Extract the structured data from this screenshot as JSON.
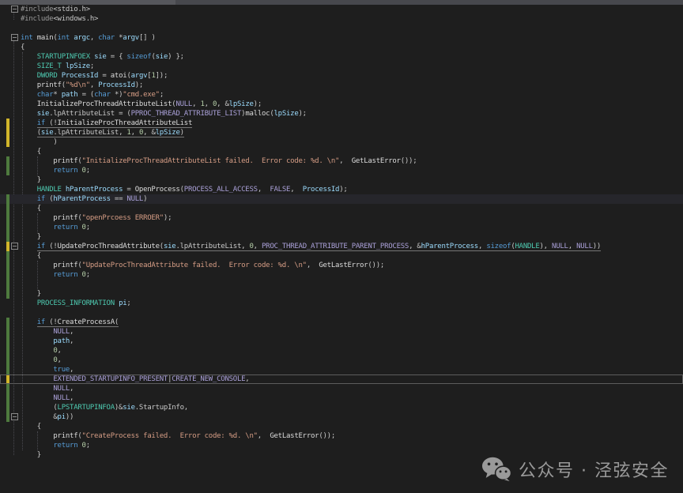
{
  "editor": {
    "palette": {
      "background": "#1e1e1e",
      "keyword": "#569cd6",
      "type": "#4ec9b0",
      "macro": "#aaa0d8",
      "local_variable": "#9cdcfe",
      "function": "#dcdcdc",
      "string": "#d69d85",
      "number": "#b5cea8",
      "plain": "#c8c8c8",
      "track_modified_unsaved": "#d1b52a",
      "track_modified_saved": "#4e7a3e"
    },
    "lines": [
      {
        "s": [
          [
            "pp",
            "#include"
          ],
          [
            "pl",
            "<stdio.h>"
          ]
        ],
        "fold": true
      },
      {
        "s": [
          [
            "pp",
            "#include"
          ],
          [
            "pl",
            "<windows.h>"
          ]
        ]
      },
      {
        "s": []
      },
      {
        "s": [
          [
            "kw",
            "int"
          ],
          [
            "pl",
            " "
          ],
          [
            "fn",
            "main"
          ],
          [
            "pl",
            "("
          ],
          [
            "kw",
            "int"
          ],
          [
            "pl",
            " "
          ],
          [
            "lv",
            "argc"
          ],
          [
            "pl",
            ", "
          ],
          [
            "kw",
            "char"
          ],
          [
            "pl",
            " *"
          ],
          [
            "lv",
            "argv"
          ],
          [
            "pl",
            "[] )"
          ]
        ],
        "fold": true
      },
      {
        "s": [
          [
            "pl",
            "{"
          ]
        ]
      },
      {
        "i": 4,
        "s": [
          [
            "ty",
            "STARTUPINFOEX"
          ],
          [
            "pl",
            " "
          ],
          [
            "lv",
            "sie"
          ],
          [
            "pl",
            " = { "
          ],
          [
            "kw",
            "sizeof"
          ],
          [
            "pl",
            "("
          ],
          [
            "lv",
            "sie"
          ],
          [
            "pl",
            ") };"
          ]
        ]
      },
      {
        "i": 4,
        "s": [
          [
            "ty",
            "SIZE_T"
          ],
          [
            "pl",
            " "
          ],
          [
            "lv",
            "lpSize"
          ],
          [
            "pl",
            ";"
          ]
        ]
      },
      {
        "i": 4,
        "s": [
          [
            "ty",
            "DWORD"
          ],
          [
            "pl",
            " "
          ],
          [
            "lv",
            "ProcessId"
          ],
          [
            "pl",
            " = "
          ],
          [
            "fn",
            "atoi"
          ],
          [
            "pl",
            "("
          ],
          [
            "lv",
            "argv"
          ],
          [
            "pl",
            "["
          ],
          [
            "nm",
            "1"
          ],
          [
            "pl",
            "]);"
          ]
        ]
      },
      {
        "i": 4,
        "s": [
          [
            "fn",
            "printf"
          ],
          [
            "pl",
            "("
          ],
          [
            "st",
            "\"%d\\n\""
          ],
          [
            "pl",
            ", "
          ],
          [
            "lv",
            "ProcessId"
          ],
          [
            "pl",
            ");"
          ]
        ]
      },
      {
        "i": 4,
        "s": [
          [
            "kw",
            "char"
          ],
          [
            "pl",
            "* "
          ],
          [
            "lv",
            "path"
          ],
          [
            "pl",
            " = ("
          ],
          [
            "kw",
            "char"
          ],
          [
            "pl",
            " *)"
          ],
          [
            "st",
            "\"cmd.exe\""
          ],
          [
            "pl",
            ";"
          ]
        ]
      },
      {
        "i": 4,
        "s": [
          [
            "fn",
            "InitializeProcThreadAttributeList"
          ],
          [
            "pl",
            "("
          ],
          [
            "mc",
            "NULL"
          ],
          [
            "pl",
            ", "
          ],
          [
            "nm",
            "1"
          ],
          [
            "pl",
            ", "
          ],
          [
            "nm",
            "0"
          ],
          [
            "pl",
            ", &"
          ],
          [
            "lv",
            "lpSize"
          ],
          [
            "pl",
            ");"
          ]
        ]
      },
      {
        "i": 4,
        "s": [
          [
            "lv",
            "sie"
          ],
          [
            "pl",
            ".lpAttributeList = ("
          ],
          [
            "mc",
            "PPROC_THREAD_ATTRIBUTE_LIST"
          ],
          [
            "pl",
            ")"
          ],
          [
            "fn",
            "malloc"
          ],
          [
            "pl",
            "("
          ],
          [
            "lv",
            "lpSize"
          ],
          [
            "pl",
            ");"
          ]
        ]
      },
      {
        "i": 4,
        "bar": "y",
        "u": true,
        "s": [
          [
            "kw",
            "if"
          ],
          [
            "pl",
            " (!"
          ],
          [
            "fn",
            "InitializeProcThreadAttributeList"
          ]
        ]
      },
      {
        "i": 4,
        "bar": "y",
        "u": true,
        "s": [
          [
            "pl",
            "("
          ],
          [
            "lv",
            "sie"
          ],
          [
            "pl",
            ".lpAttributeList, "
          ],
          [
            "nm",
            "1"
          ],
          [
            "pl",
            ", "
          ],
          [
            "nm",
            "0"
          ],
          [
            "pl",
            ", &"
          ],
          [
            "lv",
            "lpSize"
          ],
          [
            "pl",
            ")"
          ]
        ]
      },
      {
        "i": 8,
        "bar": "y",
        "s": [
          [
            "pl",
            ")"
          ]
        ]
      },
      {
        "i": 4,
        "s": [
          [
            "pl",
            "{"
          ]
        ]
      },
      {
        "i": 8,
        "bar": "g",
        "s": [
          [
            "fn",
            "printf"
          ],
          [
            "pl",
            "("
          ],
          [
            "st",
            "\"InitializeProcThreadAttributeList failed.  Error code: %d. \\n\""
          ],
          [
            "pl",
            ",  "
          ],
          [
            "fn",
            "GetLastError"
          ],
          [
            "pl",
            "());"
          ]
        ]
      },
      {
        "i": 8,
        "bar": "g",
        "s": [
          [
            "kw",
            "return"
          ],
          [
            "pl",
            " "
          ],
          [
            "nm",
            "0"
          ],
          [
            "pl",
            ";"
          ]
        ]
      },
      {
        "i": 4,
        "s": [
          [
            "pl",
            "}"
          ]
        ]
      },
      {
        "i": 4,
        "s": [
          [
            "ty",
            "HANDLE"
          ],
          [
            "pl",
            " "
          ],
          [
            "lv",
            "hParentProcess"
          ],
          [
            "pl",
            " = "
          ],
          [
            "fn",
            "OpenProcess"
          ],
          [
            "pl",
            "("
          ],
          [
            "mc",
            "PROCESS_ALL_ACCESS"
          ],
          [
            "pl",
            ",  "
          ],
          [
            "mc",
            "FALSE"
          ],
          [
            "pl",
            ",  "
          ],
          [
            "lv",
            "ProcessId"
          ],
          [
            "pl",
            ");"
          ]
        ]
      },
      {
        "i": 4,
        "bar": "g",
        "hl": true,
        "s": [
          [
            "kw",
            "if"
          ],
          [
            "pl",
            " ("
          ],
          [
            "lv",
            "hParentProcess"
          ],
          [
            "pl",
            " == "
          ],
          [
            "mc",
            "NULL"
          ],
          [
            "pl",
            ")"
          ]
        ]
      },
      {
        "i": 4,
        "bar": "g",
        "s": [
          [
            "pl",
            "{"
          ]
        ]
      },
      {
        "i": 8,
        "bar": "g",
        "s": [
          [
            "fn",
            "printf"
          ],
          [
            "pl",
            "("
          ],
          [
            "st",
            "\"openPrcoess ERROER\""
          ],
          [
            "pl",
            ");"
          ]
        ]
      },
      {
        "i": 8,
        "bar": "g",
        "s": [
          [
            "kw",
            "return"
          ],
          [
            "pl",
            " "
          ],
          [
            "nm",
            "0"
          ],
          [
            "pl",
            ";"
          ]
        ]
      },
      {
        "i": 4,
        "bar": "g",
        "s": [
          [
            "pl",
            "}"
          ]
        ]
      },
      {
        "i": 4,
        "bar": "y",
        "u": true,
        "fold": true,
        "s": [
          [
            "kw",
            "if"
          ],
          [
            "pl",
            " (!"
          ],
          [
            "fn",
            "UpdateProcThreadAttribute"
          ],
          [
            "pl",
            "("
          ],
          [
            "lv",
            "sie"
          ],
          [
            "pl",
            ".lpAttributeList, "
          ],
          [
            "nm",
            "0"
          ],
          [
            "pl",
            ", "
          ],
          [
            "mc",
            "PROC_THREAD_ATTRIBUTE_PARENT_PROCESS"
          ],
          [
            "pl",
            ", &"
          ],
          [
            "lv",
            "hParentProcess"
          ],
          [
            "pl",
            ", "
          ],
          [
            "kw",
            "sizeof"
          ],
          [
            "pl",
            "("
          ],
          [
            "ty",
            "HANDLE"
          ],
          [
            "pl",
            "), "
          ],
          [
            "mc",
            "NULL"
          ],
          [
            "pl",
            ", "
          ],
          [
            "mc",
            "NULL"
          ],
          [
            "pl",
            "))"
          ]
        ]
      },
      {
        "i": 4,
        "bar": "g",
        "s": [
          [
            "pl",
            "{"
          ]
        ]
      },
      {
        "i": 8,
        "bar": "g",
        "s": [
          [
            "fn",
            "printf"
          ],
          [
            "pl",
            "("
          ],
          [
            "st",
            "\"UpdateProcThreadAttribute failed.  Error code: %d. \\n\""
          ],
          [
            "pl",
            ",  "
          ],
          [
            "fn",
            "GetLastError"
          ],
          [
            "pl",
            "());"
          ]
        ]
      },
      {
        "i": 8,
        "bar": "g",
        "s": [
          [
            "kw",
            "return"
          ],
          [
            "pl",
            " "
          ],
          [
            "nm",
            "0"
          ],
          [
            "pl",
            ";"
          ]
        ]
      },
      {
        "bar": "g",
        "s": []
      },
      {
        "i": 4,
        "bar": "g",
        "s": [
          [
            "pl",
            "}"
          ]
        ]
      },
      {
        "i": 4,
        "s": [
          [
            "ty",
            "PROCESS_INFORMATION"
          ],
          [
            "pl",
            " "
          ],
          [
            "lv",
            "pi"
          ],
          [
            "pl",
            ";"
          ]
        ]
      },
      {
        "s": []
      },
      {
        "i": 4,
        "bar": "g",
        "u": true,
        "s": [
          [
            "kw",
            "if"
          ],
          [
            "pl",
            " (!"
          ],
          [
            "fn",
            "CreateProcessA"
          ],
          [
            "pl",
            "("
          ]
        ]
      },
      {
        "i": 8,
        "bar": "g",
        "s": [
          [
            "mc",
            "NULL"
          ],
          [
            "pl",
            ","
          ]
        ]
      },
      {
        "i": 8,
        "bar": "g",
        "s": [
          [
            "lv",
            "path"
          ],
          [
            "pl",
            ","
          ]
        ]
      },
      {
        "i": 8,
        "bar": "g",
        "s": [
          [
            "nm",
            "0"
          ],
          [
            "pl",
            ","
          ]
        ]
      },
      {
        "i": 8,
        "bar": "g",
        "s": [
          [
            "nm",
            "0"
          ],
          [
            "pl",
            ","
          ]
        ]
      },
      {
        "i": 8,
        "bar": "g",
        "s": [
          [
            "kw",
            "true"
          ],
          [
            "pl",
            ","
          ]
        ]
      },
      {
        "i": 8,
        "bar": "y",
        "cur": true,
        "s": [
          [
            "mc",
            "EXTENDED_STARTUPINFO_PRESENT"
          ],
          [
            "pl",
            "|"
          ],
          [
            "mc",
            "CREATE_NEW_CONSOLE"
          ],
          [
            "pl",
            ","
          ]
        ]
      },
      {
        "i": 8,
        "bar": "g",
        "s": [
          [
            "mc",
            "NULL"
          ],
          [
            "pl",
            ","
          ]
        ]
      },
      {
        "i": 8,
        "bar": "g",
        "s": [
          [
            "mc",
            "NULL"
          ],
          [
            "pl",
            ","
          ]
        ]
      },
      {
        "i": 8,
        "bar": "g",
        "s": [
          [
            "pl",
            "("
          ],
          [
            "ty",
            "LPSTARTUPINFOA"
          ],
          [
            "pl",
            ")&"
          ],
          [
            "lv",
            "sie"
          ],
          [
            "pl",
            ".StartupInfo,"
          ]
        ]
      },
      {
        "i": 8,
        "bar": "g",
        "fold": true,
        "s": [
          [
            "pl",
            "&"
          ],
          [
            "lv",
            "pi"
          ],
          [
            "pl",
            "))"
          ]
        ]
      },
      {
        "i": 4,
        "s": [
          [
            "pl",
            "{"
          ]
        ]
      },
      {
        "i": 8,
        "s": [
          [
            "fn",
            "printf"
          ],
          [
            "pl",
            "("
          ],
          [
            "st",
            "\"CreateProcess failed.  Error code: %d. \\n\""
          ],
          [
            "pl",
            ",  "
          ],
          [
            "fn",
            "GetLastError"
          ],
          [
            "pl",
            "());"
          ]
        ]
      },
      {
        "i": 8,
        "s": [
          [
            "kw",
            "return"
          ],
          [
            "pl",
            " "
          ],
          [
            "nm",
            "0"
          ],
          [
            "pl",
            ";"
          ]
        ]
      },
      {
        "i": 4,
        "s": [
          [
            "pl",
            "}"
          ]
        ]
      }
    ]
  },
  "watermark": {
    "icon": "wechat-icon",
    "text": "公众号 · 泾弦安全",
    "color": "#9a9a9a"
  }
}
